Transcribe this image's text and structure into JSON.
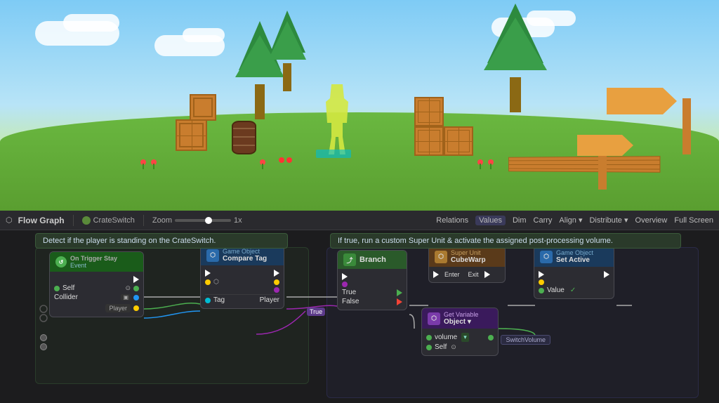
{
  "toolbar": {
    "icon": "⬡",
    "title": "Flow Graph",
    "breadcrumb": "CrateSwitch",
    "zoom_label": "Zoom",
    "zoom_value": "1x",
    "right_items": [
      "Relations",
      "Values",
      "Dim",
      "Carry",
      "Align ▾",
      "Distribute ▾",
      "Overview",
      "Full Screen"
    ]
  },
  "desc_left": "Detect if the player is standing on the CrateSwitch.",
  "desc_right": "If true, run a custom Super Unit & activate the assigned post-processing volume.",
  "nodes": {
    "trigger": {
      "header_line1": "On Trigger Stay",
      "header_line2": "Event",
      "ports_out": [
        "Self",
        "Collider"
      ],
      "self_label": "Self",
      "collider_label": "Collider",
      "player_label": "Player"
    },
    "compare": {
      "header_line1": "Game Object",
      "header_line2": "Compare Tag",
      "tag_label": "Tag",
      "tag_value": "Player"
    },
    "branch": {
      "header": "Branch",
      "true_label": "True",
      "false_label": "False"
    },
    "super_unit": {
      "header_line1": "Super Unit",
      "header_line2": "CubeWarp",
      "enter_label": "Enter",
      "exit_label": "Exit"
    },
    "set_active": {
      "header_line1": "Game Object",
      "header_line2": "Set Active",
      "value_label": "Value",
      "checkmark": "✓"
    },
    "get_variable": {
      "header_line1": "Get Variable",
      "header_line2": "Object ▾",
      "volume_label": "volume",
      "self_label": "Self",
      "switch_volume": "SwitchVolume"
    }
  },
  "wire_label": "True",
  "colors": {
    "accent_green": "#4caf50",
    "accent_blue": "#2196f3",
    "accent_purple": "#9c27b0",
    "node_dark": "#2c2c32",
    "header_green": "#1a5c1a",
    "header_blue": "#1a3a5c",
    "header_orange": "#5a3a1a",
    "header_purple": "#3a1a5c"
  }
}
